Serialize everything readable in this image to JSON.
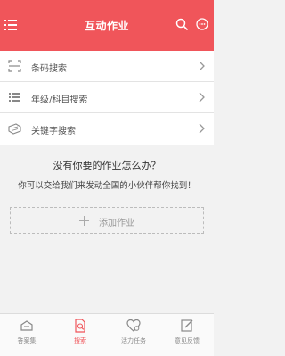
{
  "header": {
    "title": "互动作业",
    "background": "#f0555a"
  },
  "menu": {
    "items": [
      {
        "label": "条码搜索",
        "icon": "barcode-scan-icon"
      },
      {
        "label": "年级/科目搜索",
        "icon": "list-icon"
      },
      {
        "label": "关键字搜索",
        "icon": "keyword-tag-icon"
      }
    ]
  },
  "prompt": {
    "title": "没有你要的作业怎么办？",
    "subtitle": "你可以交给我们来发动全国的小伙伴帮你找到！",
    "add_label": "添加作业"
  },
  "bottom_nav": {
    "items": [
      {
        "label": "答案集",
        "icon": "answer-box-icon",
        "active": false
      },
      {
        "label": "搜索",
        "icon": "search-doc-icon",
        "active": true
      },
      {
        "label": "活力任务",
        "icon": "heart-task-icon",
        "active": false
      },
      {
        "label": "意见反馈",
        "icon": "feedback-edit-icon",
        "active": false
      }
    ],
    "active_color": "#f0555a"
  }
}
